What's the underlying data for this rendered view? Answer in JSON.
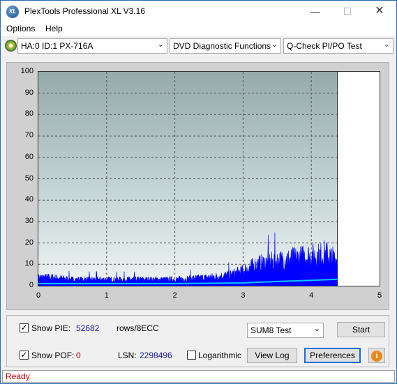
{
  "window": {
    "title": "PlexTools Professional XL V3.16",
    "icon_label": "XL",
    "minimize": "—",
    "maximize": "☐",
    "close": "✕"
  },
  "menu": {
    "options": "Options",
    "help": "Help"
  },
  "toolbar": {
    "drive": "HA:0 ID:1  PX-716A",
    "function": "DVD Diagnostic Functions",
    "test": "Q-Check PI/PO Test"
  },
  "chart_data": {
    "type": "area",
    "y_ticks": [
      "100",
      "90",
      "80",
      "70",
      "60",
      "50",
      "40",
      "30",
      "20",
      "10",
      "0"
    ],
    "x_ticks": [
      "0",
      "1",
      "2",
      "3",
      "4",
      "5"
    ],
    "ylim": [
      0,
      100
    ],
    "xlim": [
      0,
      5
    ],
    "grid": true,
    "end_marker_x": 4.38,
    "series": [
      {
        "color": "#0000ff",
        "x": [
          0,
          0.2,
          0.5,
          1.0,
          1.5,
          2.0,
          2.5,
          2.8,
          3.0,
          3.2,
          3.4,
          3.6,
          3.8,
          4.0,
          4.1,
          4.2,
          4.3,
          4.38
        ],
        "y": [
          4,
          4,
          3,
          3,
          3,
          3,
          4,
          5,
          7,
          10,
          11,
          12,
          13,
          14,
          14,
          15,
          13,
          12
        ]
      },
      {
        "color": "#00c8ff",
        "x": [
          0,
          1,
          2,
          3,
          3.5,
          4,
          4.38
        ],
        "y": [
          1,
          1,
          1,
          1.3,
          2,
          2.5,
          3
        ]
      }
    ]
  },
  "panel": {
    "show_pie_label": "Show PIE:",
    "pie_value": "52682",
    "rows_unit": "rows/8ECC",
    "show_pof_label": "Show POF:",
    "pof_value": "0",
    "lsn_label": "LSN:",
    "lsn_value": "2298496",
    "logarithmic_label": "Logarithmic",
    "sum_select": "SUM8 Test",
    "start": "Start",
    "view_log": "View Log",
    "preferences": "Preferences",
    "info": "i",
    "check_mark": "✓"
  },
  "status": {
    "text": "Ready"
  }
}
